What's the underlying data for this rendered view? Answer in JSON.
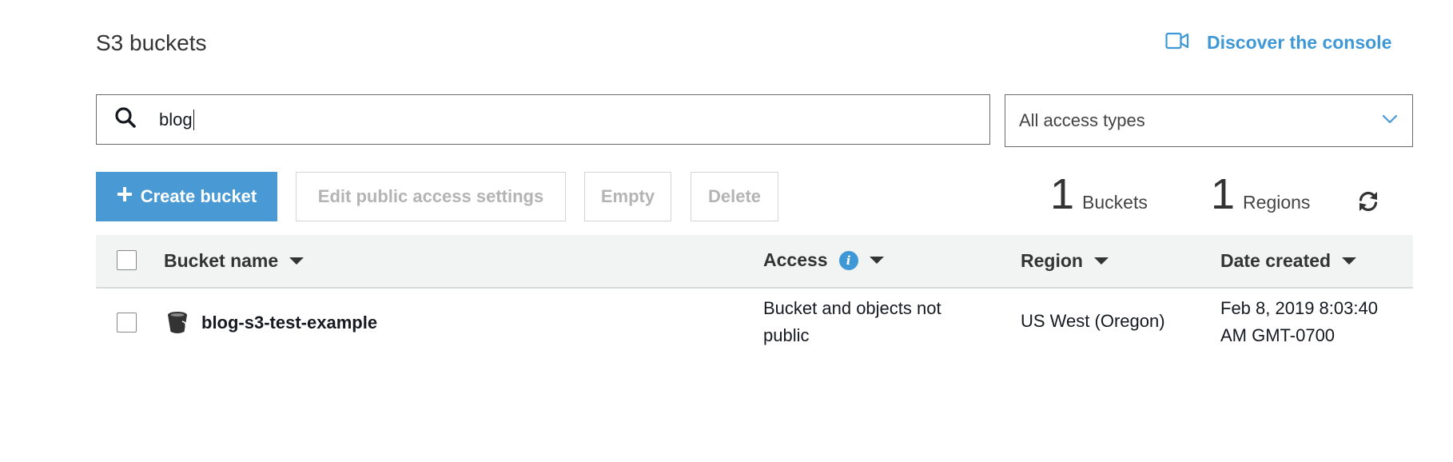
{
  "header": {
    "title": "S3 buckets",
    "discover_label": "Discover the console"
  },
  "search": {
    "value": "blog"
  },
  "access_filter": {
    "selected": "All access types"
  },
  "toolbar": {
    "create_label": "Create bucket",
    "edit_label": "Edit public access settings",
    "empty_label": "Empty",
    "delete_label": "Delete"
  },
  "stats": {
    "buckets_count": "1",
    "buckets_label": "Buckets",
    "regions_count": "1",
    "regions_label": "Regions"
  },
  "table": {
    "columns": [
      "Bucket name",
      "Access",
      "Region",
      "Date created"
    ],
    "rows": [
      {
        "name": "blog-s3-test-example",
        "access_line1": "Bucket and objects not",
        "access_line2": "public",
        "region": "US West (Oregon)",
        "date_line1": "Feb 8, 2019 8:03:40",
        "date_line2": "AM GMT-0700"
      }
    ]
  },
  "icons": {
    "discover": "video-camera-icon",
    "search": "search-icon",
    "dropdown": "chevron-down-icon",
    "create": "plus-icon",
    "refresh": "refresh-icon",
    "info": "info-icon",
    "bucket": "bucket-icon"
  },
  "colors": {
    "accent": "#4999d5",
    "link": "#3f98d6",
    "header_bg": "#f2f4f4"
  }
}
